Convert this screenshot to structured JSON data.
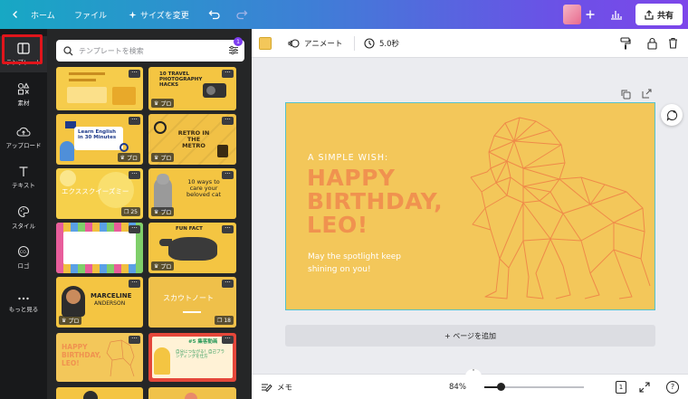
{
  "topbar": {
    "home_label": "ホーム",
    "file_label": "ファイル",
    "resize_label": "サイズを変更",
    "share_label": "共有"
  },
  "rail": {
    "items": [
      {
        "label": "テンプレート",
        "icon": "template-icon"
      },
      {
        "label": "素材",
        "icon": "elements-icon"
      },
      {
        "label": "アップロード",
        "icon": "upload-icon"
      },
      {
        "label": "テキスト",
        "icon": "text-icon"
      },
      {
        "label": "スタイル",
        "icon": "palette-icon"
      },
      {
        "label": "ロゴ",
        "icon": "logo-icon"
      },
      {
        "label": "もっと見る",
        "icon": "more-icon"
      }
    ]
  },
  "panel": {
    "search_placeholder": "テンプレートを検索",
    "filter_badge": "1",
    "pro_label": "プロ",
    "thumbnails": {
      "t2_title": "10 TRAVEL PHOTOGRAPHY HACKS",
      "t3_title": "Learn English in 30 Minutes",
      "t4_title": "RETRO IN THE METRO",
      "t5_title": "エクススクイーズミー",
      "t5_count": "25",
      "t6_title": "10 ways to care your beloved cat",
      "t8_title": "FUN FACT",
      "t9_title1": "MARCELINE",
      "t9_title2": "ANDERSON",
      "t10_title": "スカウトノート",
      "t10_count": "18",
      "t11_title1": "HAPPY",
      "t11_title2": "BIRTHDAY,",
      "t11_title3": "LEO!",
      "t12_title": "#5 集客動画",
      "t12_sub": "自分につながる！自己ブランディングを仕方"
    }
  },
  "editor_toolbar": {
    "animate_label": "アニメート",
    "duration_label": "5.0秒",
    "color_swatch": "#f3c75a"
  },
  "design": {
    "subtitle": "A SIMPLE WISH:",
    "title_line1": "HAPPY",
    "title_line2": "BIRTHDAY,",
    "title_line3": "LEO!",
    "message_line1": "May the spotlight keep",
    "message_line2": "shining on you!",
    "accent_color": "#f0924f",
    "background_color": "#f3c75a"
  },
  "add_page_label": "+ ページを追加",
  "bottombar": {
    "notes_label": "メモ",
    "zoom_label": "84%",
    "page_count": "1",
    "help_label": "?"
  }
}
